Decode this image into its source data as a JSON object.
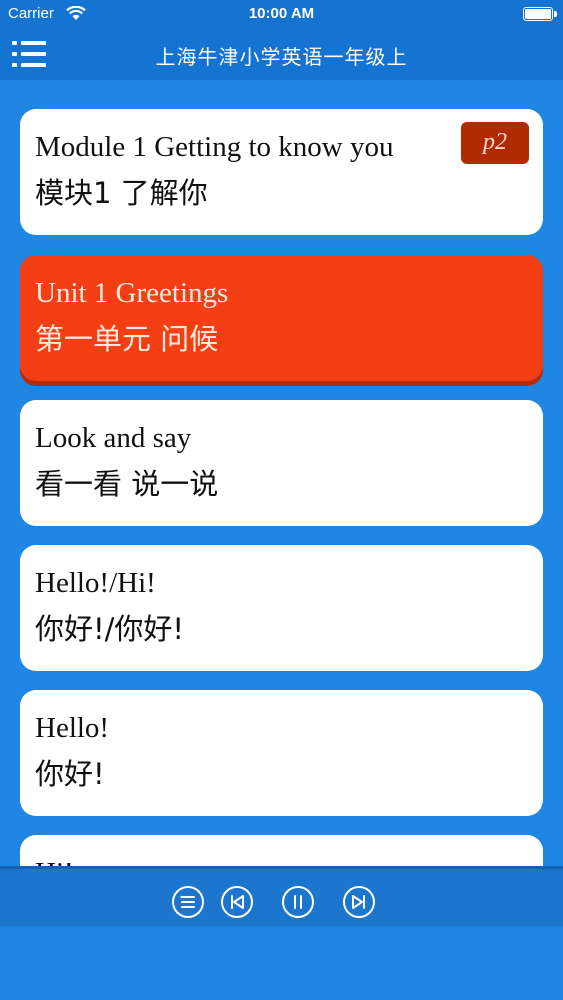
{
  "status_bar": {
    "carrier": "Carrier",
    "time": "10:00 AM"
  },
  "nav": {
    "title": "上海牛津小学英语一年级上",
    "menu_icon": "hamburger-menu-icon"
  },
  "list": [
    {
      "en": "Module 1 Getting to know you",
      "zh": "模块1 了解你",
      "badge": "p2",
      "active": false
    },
    {
      "en": "Unit 1 Greetings",
      "zh": "第一单元 问候",
      "active": true
    },
    {
      "en": "Look and say",
      "zh": "看一看 说一说",
      "active": false
    },
    {
      "en": "Hello!/Hi!",
      "zh": "你好!/你好!",
      "active": false
    },
    {
      "en": "Hello!",
      "zh": "你好!",
      "active": false
    },
    {
      "en": "Hi!",
      "zh": "",
      "active": false
    }
  ],
  "player": {
    "controls": [
      "playlist-icon",
      "previous-icon",
      "pause-icon",
      "next-icon"
    ]
  },
  "colors": {
    "background": "#1f86e3",
    "bar": "#1573d1",
    "active_card": "#f43f14",
    "badge": "#b02a04"
  }
}
